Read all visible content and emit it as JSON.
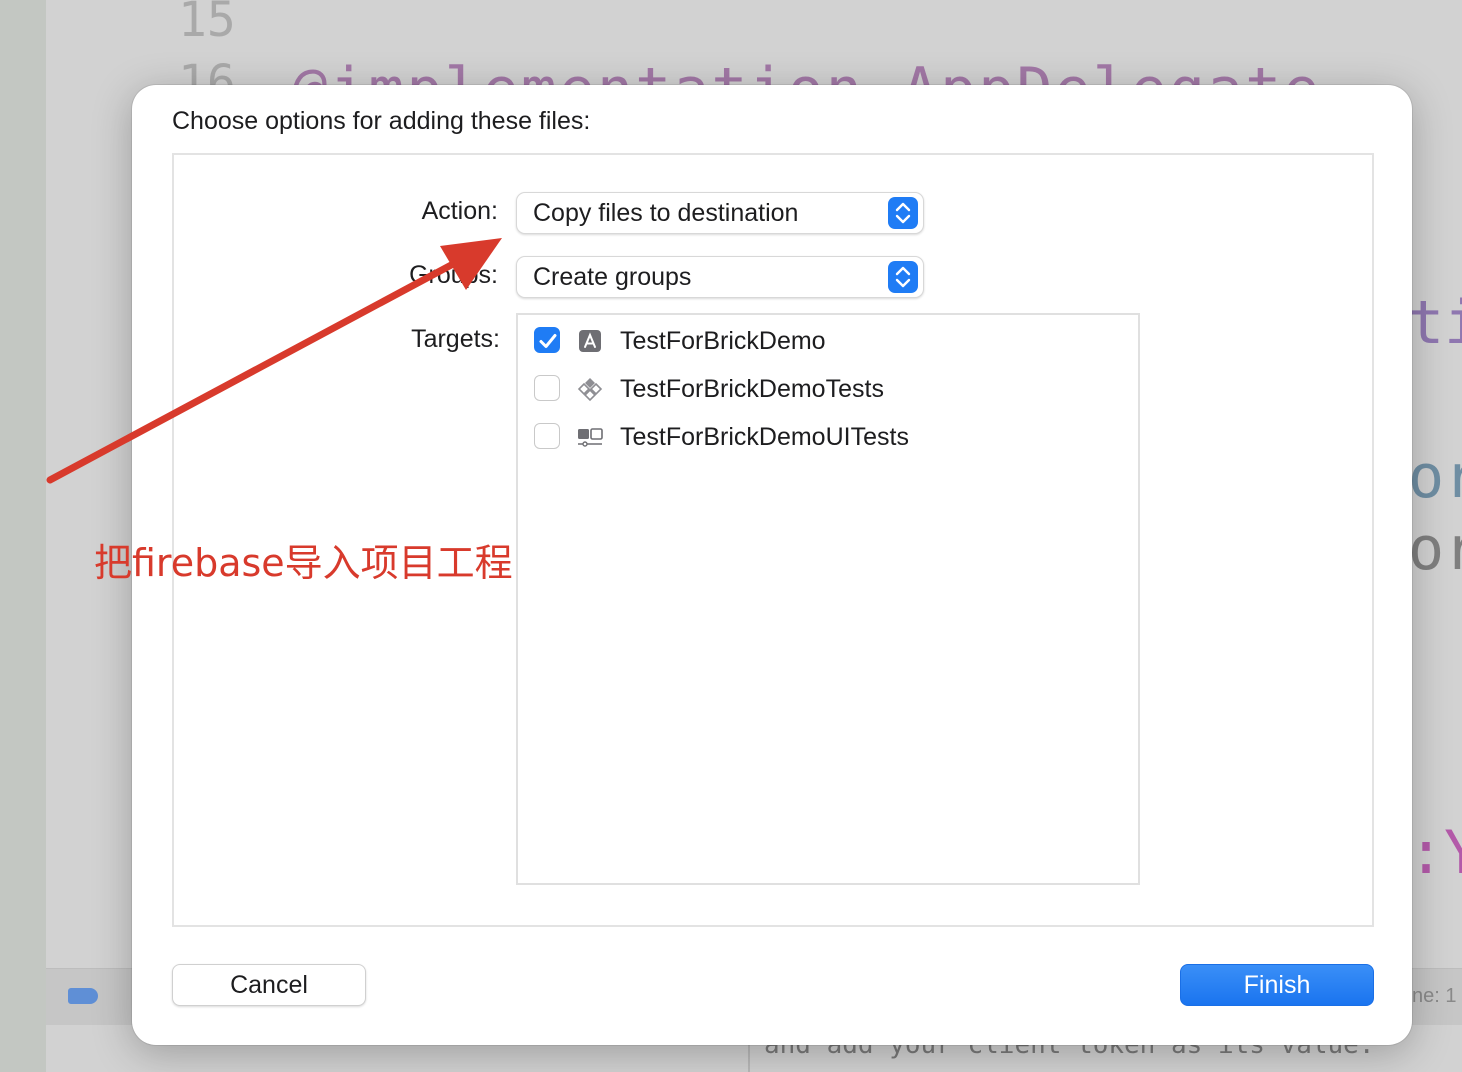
{
  "background": {
    "line_15": "15",
    "line_16": "16",
    "code_line": "@implementation AppDelegate",
    "frag_1": "ti",
    "frag_2": "or",
    "frag_3": "or",
    "frag_4": ":Y",
    "status_right": "ne: 1",
    "console_text": "and add your client token as its value."
  },
  "dialog": {
    "title": "Choose options for adding these files:",
    "action_label": "Action:",
    "action_value": "Copy files to destination",
    "groups_label": "Groups:",
    "groups_value": "Create groups",
    "targets_label": "Targets:",
    "targets": [
      {
        "name": "TestForBrickDemo",
        "checked": true,
        "icon": "app-icon"
      },
      {
        "name": "TestForBrickDemoTests",
        "checked": false,
        "icon": "test-bundle-icon"
      },
      {
        "name": "TestForBrickDemoUITests",
        "checked": false,
        "icon": "ui-test-bundle-icon"
      }
    ],
    "cancel_label": "Cancel",
    "finish_label": "Finish"
  },
  "annotation": {
    "text": "把firebase导入项目工程",
    "color": "#d83a2c"
  },
  "colors": {
    "accent": "#1f7cf5"
  }
}
